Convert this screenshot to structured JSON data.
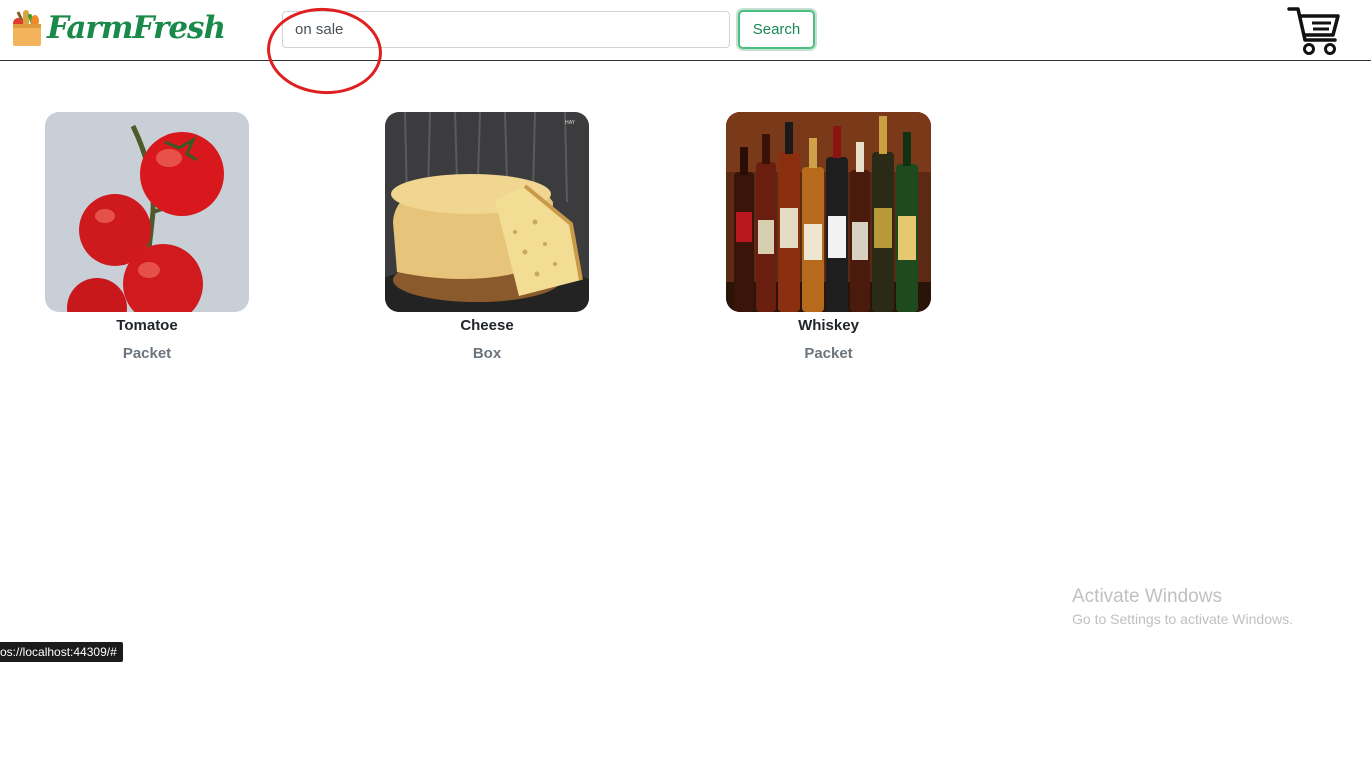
{
  "header": {
    "brand": "FarmFresh",
    "search": {
      "value": "on sale",
      "button_label": "Search"
    }
  },
  "products": [
    {
      "name": "Tomatoe",
      "unit": "Packet"
    },
    {
      "name": "Cheese",
      "unit": "Box"
    },
    {
      "name": "Whiskey",
      "unit": "Packet"
    }
  ],
  "annotation": {
    "color": "#e02020"
  },
  "status_bar": {
    "url": "os://localhost:44309/#"
  },
  "watermark": {
    "title": "Activate Windows",
    "subtitle": "Go to Settings to activate Windows."
  },
  "colors": {
    "brand": "#1a8a4a",
    "accent": "#198754",
    "unit_text": "#6c757d"
  }
}
